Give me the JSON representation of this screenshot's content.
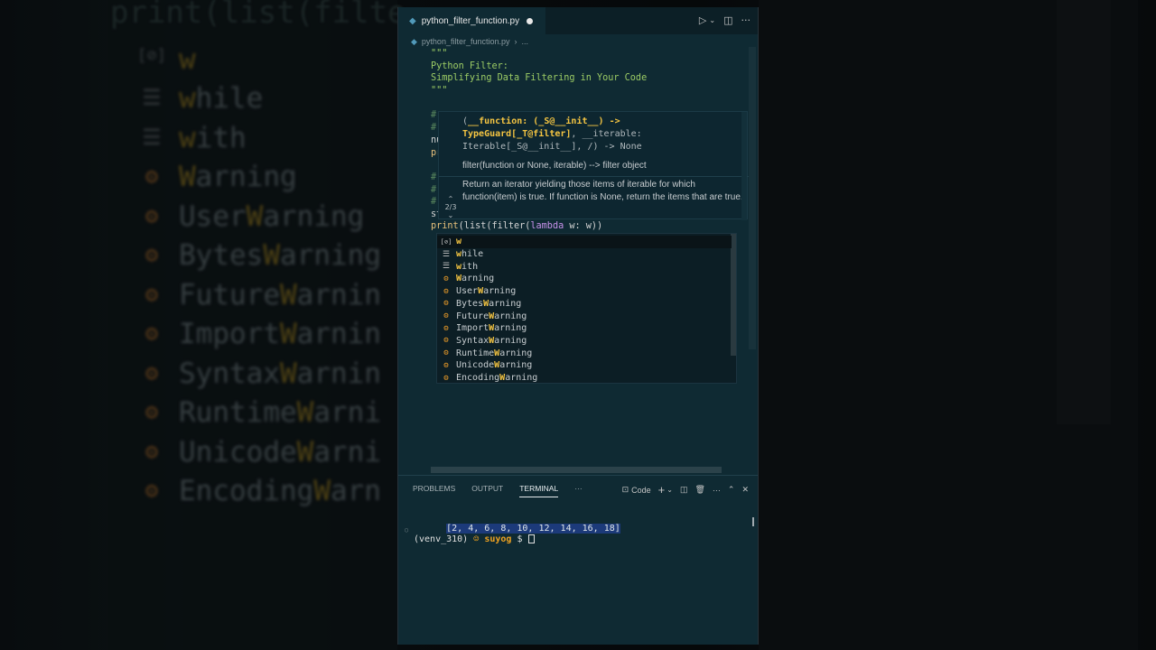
{
  "background": {
    "title": "print(list(filte",
    "items": [
      {
        "icon": "variable-icon",
        "pre": "",
        "match": "w",
        "post": "",
        "matchcase": "w"
      },
      {
        "icon": "keyword-icon",
        "pre": "",
        "match": "w",
        "post": "hile"
      },
      {
        "icon": "keyword-icon",
        "pre": "",
        "match": "w",
        "post": "ith"
      },
      {
        "icon": "class-icon",
        "pre": "",
        "match": "W",
        "post": "arning"
      },
      {
        "icon": "class-icon",
        "pre": "User",
        "match": "W",
        "post": "arning"
      },
      {
        "icon": "class-icon",
        "pre": "Bytes",
        "match": "W",
        "post": "arning"
      },
      {
        "icon": "class-icon",
        "pre": "Future",
        "match": "W",
        "post": "arnin"
      },
      {
        "icon": "class-icon",
        "pre": "Import",
        "match": "W",
        "post": "arnin"
      },
      {
        "icon": "class-icon",
        "pre": "Syntax",
        "match": "W",
        "post": "arnin"
      },
      {
        "icon": "class-icon",
        "pre": "Runtime",
        "match": "W",
        "post": "arni"
      },
      {
        "icon": "class-icon",
        "pre": "Unicode",
        "match": "W",
        "post": "arni"
      },
      {
        "icon": "class-icon",
        "pre": "Encoding",
        "match": "W",
        "post": "arn"
      }
    ]
  },
  "editor": {
    "tab_name": "python_filter_function.py",
    "breadcrumb_file": "python_filter_function.py",
    "breadcrumb_more": "...",
    "docstring": [
      "\"\"\"",
      "Python Filter:",
      "Simplifying Data Filtering in Your Code",
      "\"\"\""
    ],
    "hidden_lines": [
      {
        "text": "#",
        "kind": "com"
      },
      {
        "text": "#",
        "kind": "com"
      },
      {
        "text": "nu",
        "kind": "txt"
      },
      {
        "text": "pr",
        "kind": "fn"
      },
      {
        "text": "#",
        "kind": "com"
      },
      {
        "text": "#",
        "kind": "com"
      },
      {
        "text": "#",
        "kind": "com"
      },
      {
        "text": "st",
        "kind": "txt"
      }
    ],
    "current_line": {
      "fn": "print",
      "open": "(list(filter(",
      "kw": "lambda",
      "rest": " w: w",
      "close": "))"
    },
    "signature": {
      "line1_pre": "(",
      "line1_bold": "__function: (_S@__init__) ->",
      "line2_bold": "TypeGuard[_T@filter]",
      "line2_rest": ", __iterable:",
      "line3": "Iterable[_S@__init__], /) -> None",
      "counter": "2/3",
      "short_doc": "filter(function or None, iterable) --> filter object",
      "long_doc": "Return an iterator yielding those items of iterable for which function(item) is true. If function is None, return the items that are true."
    },
    "suggestions": [
      {
        "icon": "variable-icon",
        "match": "w",
        "rest": "",
        "kind": "var"
      },
      {
        "icon": "keyword-icon",
        "match": "w",
        "rest": "hile",
        "kind": "kw"
      },
      {
        "icon": "keyword-icon",
        "match": "w",
        "rest": "ith",
        "kind": "kw"
      },
      {
        "icon": "class-icon",
        "pre": "",
        "match": "W",
        "rest": "arning",
        "kind": "cls"
      },
      {
        "icon": "class-icon",
        "pre": "User",
        "match": "W",
        "rest": "arning",
        "kind": "cls"
      },
      {
        "icon": "class-icon",
        "pre": "Bytes",
        "match": "W",
        "rest": "arning",
        "kind": "cls"
      },
      {
        "icon": "class-icon",
        "pre": "Future",
        "match": "W",
        "rest": "arning",
        "kind": "cls"
      },
      {
        "icon": "class-icon",
        "pre": "Import",
        "match": "W",
        "rest": "arning",
        "kind": "cls"
      },
      {
        "icon": "class-icon",
        "pre": "Syntax",
        "match": "W",
        "rest": "arning",
        "kind": "cls"
      },
      {
        "icon": "class-icon",
        "pre": "Runtime",
        "match": "W",
        "rest": "arning",
        "kind": "cls"
      },
      {
        "icon": "class-icon",
        "pre": "Unicode",
        "match": "W",
        "rest": "arning",
        "kind": "cls"
      },
      {
        "icon": "class-icon",
        "pre": "Encoding",
        "match": "W",
        "rest": "arning",
        "kind": "cls"
      }
    ]
  },
  "panel": {
    "tabs": [
      "PROBLEMS",
      "OUTPUT",
      "TERMINAL",
      "···"
    ],
    "active_tab": "TERMINAL",
    "shell_label": "Code",
    "output_line": "[2, 4, 6, 8, 10, 12, 14, 16, 18]",
    "prompt_env": "(venv_310)",
    "prompt_user": "suyog",
    "prompt_symbol": "$"
  },
  "colors": {
    "editor_bg": "#0f2a33",
    "match_highlight": "#f5c542",
    "class_icon": "#ee9d28",
    "docstring": "#9ccc65"
  }
}
